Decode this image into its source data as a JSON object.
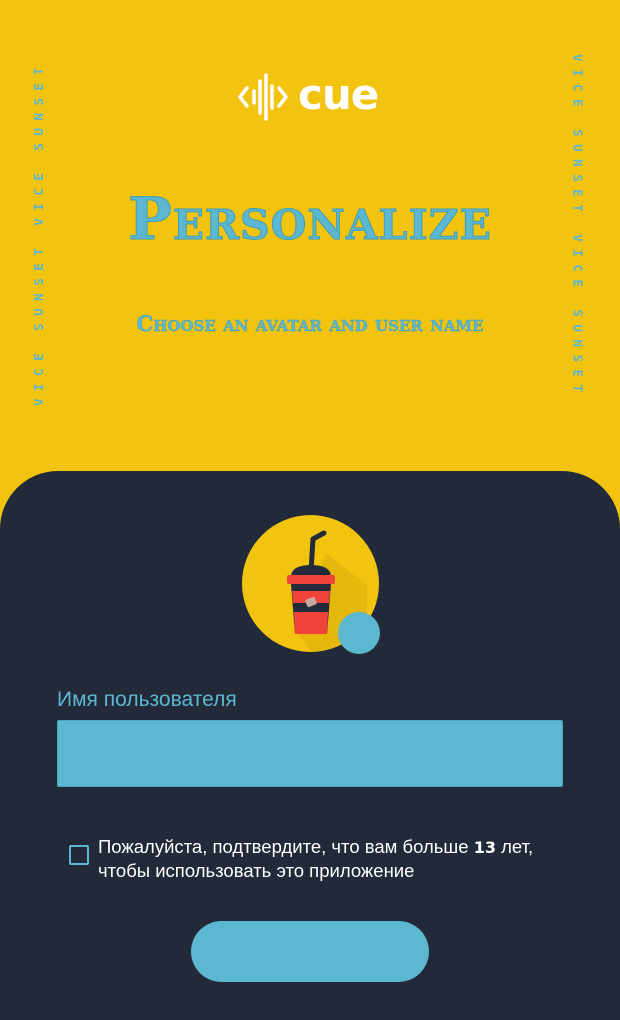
{
  "header": {
    "logo_text": "cue",
    "side_text_left": "VICE SUNSET VICE SUNSET",
    "side_text_right": "VICE SUNSET VICE SUNSET",
    "title": "Personalize",
    "subtitle": "Choose an avatar and user name"
  },
  "avatar": {
    "icon": "drink-cup-icon"
  },
  "form": {
    "username_label": "Имя пользователя",
    "username_value": "",
    "username_placeholder": "",
    "age_checkbox_checked": false,
    "age_text_before": "Пожалуйста, подтвердите, что вам больше ",
    "age_number": "13",
    "age_text_after": " лет, чтобы использовать это приложение",
    "submit_label": ""
  },
  "colors": {
    "background_yellow": "#F2C40F",
    "panel_dark": "#222938",
    "accent_blue": "#5BB8D0",
    "cup_red": "#F0433A",
    "cup_dark": "#232A3A"
  }
}
